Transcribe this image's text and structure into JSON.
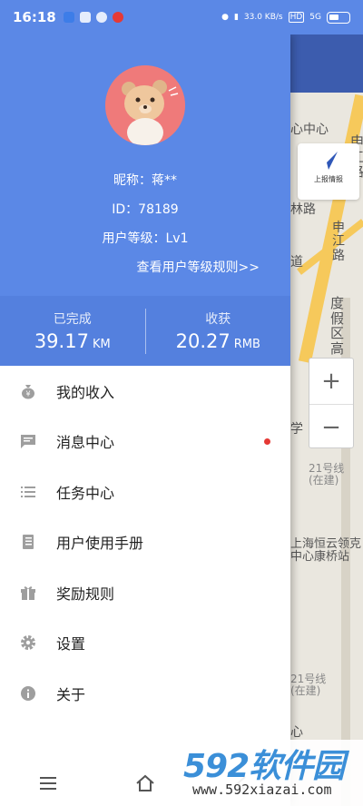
{
  "status_bar": {
    "time": "16:18",
    "speed": "33.0 KB/s",
    "hd": "HD",
    "network": "5G"
  },
  "profile": {
    "nickname": "昵称：蒋**",
    "id": "ID：78189",
    "level": "用户等级：Lv1",
    "level_rules_link": "查看用户等级规则>>"
  },
  "stats": {
    "completed_label": "已完成",
    "completed_value": "39.17",
    "completed_unit": "KM",
    "income_label": "收获",
    "income_value": "20.27",
    "income_unit": "RMB"
  },
  "menu": [
    {
      "label": "我的收入",
      "icon": "money-bag-icon",
      "badge": false
    },
    {
      "label": "消息中心",
      "icon": "message-icon",
      "badge": true
    },
    {
      "label": "任务中心",
      "icon": "list-icon",
      "badge": false
    },
    {
      "label": "用户使用手册",
      "icon": "manual-icon",
      "badge": false
    },
    {
      "label": "奖励规则",
      "icon": "gift-icon",
      "badge": false
    },
    {
      "label": "设置",
      "icon": "gear-icon",
      "badge": false
    },
    {
      "label": "关于",
      "icon": "info-icon",
      "badge": false
    }
  ],
  "map": {
    "labels": [
      "心中心",
      "申江路",
      "上报情报",
      "林路",
      "申江路",
      "度假区高",
      "道",
      "学",
      "21号线(在建)",
      "上海恒云领克中心康桥站",
      "21号线(在建)",
      "心"
    ],
    "report_label": "上报情报",
    "zoom_in": "+",
    "zoom_out": "−"
  },
  "watermark": {
    "logo": "592软件园",
    "url": "www.592xiazai.com"
  },
  "colors": {
    "header_blue": "#5b88e6",
    "stats_blue": "#5480de",
    "badge_red": "#e53935"
  }
}
